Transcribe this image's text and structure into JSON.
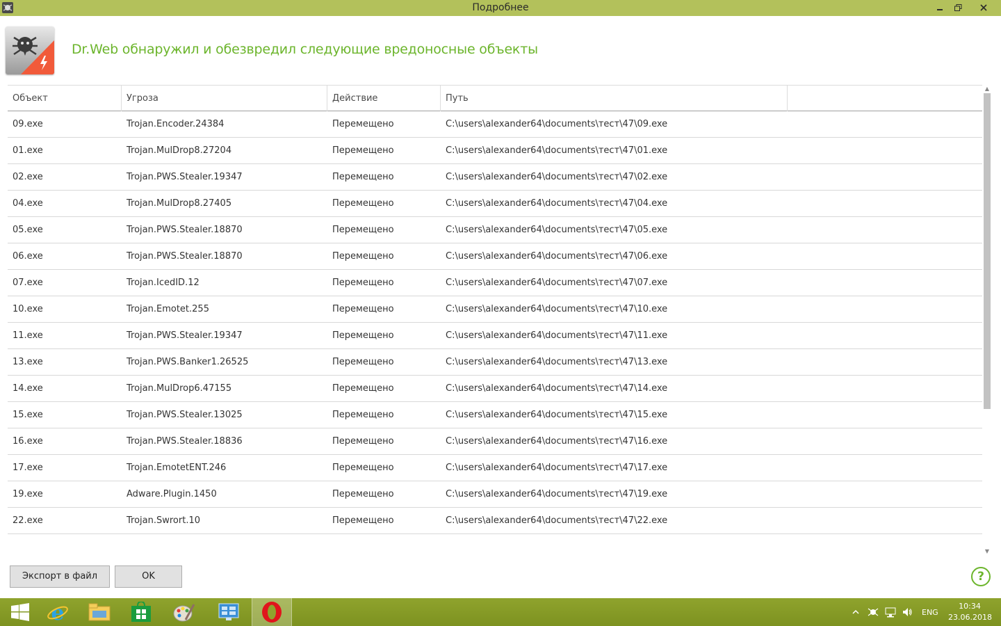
{
  "window": {
    "title": "Подробнее",
    "controls": [
      "minimize",
      "maximize",
      "close"
    ]
  },
  "header": {
    "logo_icon": "drweb-spider-icon",
    "heading": "Dr.Web обнаружил и обезвредил следующие вредоносные объекты",
    "heading_color": "#6cb52c"
  },
  "table": {
    "columns": [
      "Объект",
      "Угроза",
      "Действие",
      "Путь"
    ],
    "rows": [
      {
        "object": "09.exe",
        "threat": "Trojan.Encoder.24384",
        "action": "Перемещено",
        "path": "C:\\users\\alexander64\\documents\\тест\\47\\09.exe"
      },
      {
        "object": "01.exe",
        "threat": "Trojan.MulDrop8.27204",
        "action": "Перемещено",
        "path": "C:\\users\\alexander64\\documents\\тест\\47\\01.exe"
      },
      {
        "object": "02.exe",
        "threat": "Trojan.PWS.Stealer.19347",
        "action": "Перемещено",
        "path": "C:\\users\\alexander64\\documents\\тест\\47\\02.exe"
      },
      {
        "object": "04.exe",
        "threat": "Trojan.MulDrop8.27405",
        "action": "Перемещено",
        "path": "C:\\users\\alexander64\\documents\\тест\\47\\04.exe"
      },
      {
        "object": "05.exe",
        "threat": "Trojan.PWS.Stealer.18870",
        "action": "Перемещено",
        "path": "C:\\users\\alexander64\\documents\\тест\\47\\05.exe"
      },
      {
        "object": "06.exe",
        "threat": "Trojan.PWS.Stealer.18870",
        "action": "Перемещено",
        "path": "C:\\users\\alexander64\\documents\\тест\\47\\06.exe"
      },
      {
        "object": "07.exe",
        "threat": "Trojan.IcedID.12",
        "action": "Перемещено",
        "path": "C:\\users\\alexander64\\documents\\тест\\47\\07.exe"
      },
      {
        "object": "10.exe",
        "threat": "Trojan.Emotet.255",
        "action": "Перемещено",
        "path": "C:\\users\\alexander64\\documents\\тест\\47\\10.exe"
      },
      {
        "object": "11.exe",
        "threat": "Trojan.PWS.Stealer.19347",
        "action": "Перемещено",
        "path": "C:\\users\\alexander64\\documents\\тест\\47\\11.exe"
      },
      {
        "object": "13.exe",
        "threat": "Trojan.PWS.Banker1.26525",
        "action": "Перемещено",
        "path": "C:\\users\\alexander64\\documents\\тест\\47\\13.exe"
      },
      {
        "object": "14.exe",
        "threat": "Trojan.MulDrop6.47155",
        "action": "Перемещено",
        "path": "C:\\users\\alexander64\\documents\\тест\\47\\14.exe"
      },
      {
        "object": "15.exe",
        "threat": "Trojan.PWS.Stealer.13025",
        "action": "Перемещено",
        "path": "C:\\users\\alexander64\\documents\\тест\\47\\15.exe"
      },
      {
        "object": "16.exe",
        "threat": "Trojan.PWS.Stealer.18836",
        "action": "Перемещено",
        "path": "C:\\users\\alexander64\\documents\\тест\\47\\16.exe"
      },
      {
        "object": "17.exe",
        "threat": "Trojan.EmotetENT.246",
        "action": "Перемещено",
        "path": "C:\\users\\alexander64\\documents\\тест\\47\\17.exe"
      },
      {
        "object": "19.exe",
        "threat": "Adware.Plugin.1450",
        "action": "Перемещено",
        "path": "C:\\users\\alexander64\\documents\\тест\\47\\19.exe"
      },
      {
        "object": "22.exe",
        "threat": "Trojan.Swrort.10",
        "action": "Перемещено",
        "path": "C:\\users\\alexander64\\documents\\тест\\47\\22.exe"
      }
    ]
  },
  "buttons": {
    "export_label": "Экспорт в файл",
    "ok_label": "OK",
    "help_label": "?"
  },
  "taskbar": {
    "items": [
      "start-icon",
      "internet-explorer-icon",
      "file-explorer-icon",
      "store-icon",
      "paint-icon",
      "control-panel-icon",
      "opera-icon"
    ],
    "active_item": "opera-icon",
    "tray_icons": [
      "show-hidden-icons-chevron",
      "drweb-tray-icon",
      "network-icon",
      "volume-icon"
    ],
    "language": "ENG",
    "time": "10:34",
    "date": "23.06.2018"
  },
  "colors": {
    "titlebar": "#b3c15b",
    "taskbar": "#8fa32d",
    "accent_green": "#6cb52c",
    "logo_orange": "#f15a3a"
  }
}
